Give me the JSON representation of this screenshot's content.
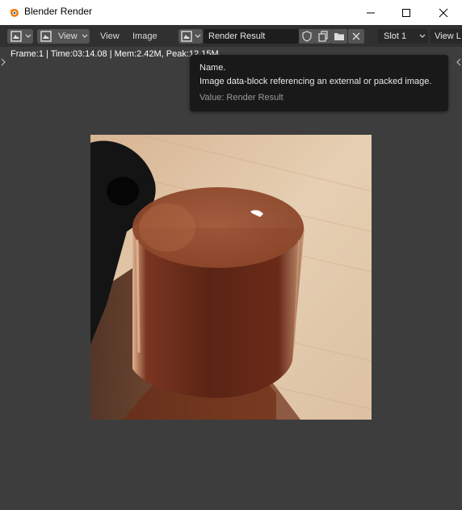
{
  "window": {
    "title": "Blender Render",
    "minimize_icon": "minimize-icon",
    "maximize_icon": "maximize-icon",
    "close_icon": "close-icon"
  },
  "header": {
    "editor_type_icon": "image-editor-icon",
    "view_menu_selector": "View",
    "menu_view": "View",
    "menu_image": "Image",
    "image_browse_icon": "image-browse-icon",
    "image_name": "Render Result",
    "fake_user_icon": "shield-icon",
    "new_image_icon": "duplicate-icon",
    "open_image_icon": "folder-icon",
    "unlink_icon": "x-icon",
    "slot": "Slot 1",
    "view_layer": "View L"
  },
  "stats": {
    "text": "Frame:1 | Time:03:14.08 | Mem:2.42M, Peak:12.15M"
  },
  "tooltip": {
    "title": "Name.",
    "description": "Image data-block referencing an external or packed image.",
    "value": "Value: Render Result"
  },
  "render_image": {
    "subject": "rendered glass cylinder on wooden surface with dark object"
  }
}
